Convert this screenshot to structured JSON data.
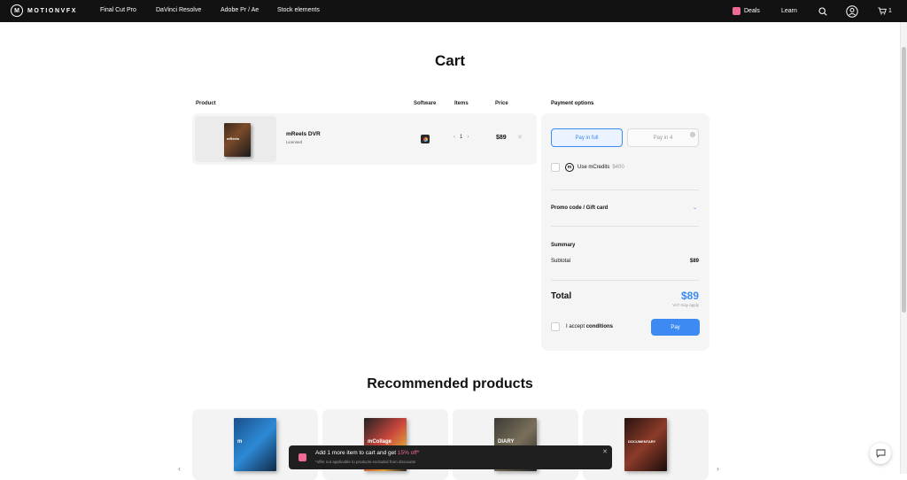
{
  "nav": {
    "brand": "MOTIONVFX",
    "links": [
      "Final Cut Pro",
      "DaVinci Resolve",
      "Adobe Pr / Ae",
      "Stock elements"
    ],
    "deals": "Deals",
    "learn": "Learn",
    "cart_count": "1"
  },
  "page": {
    "title": "Cart"
  },
  "cart": {
    "columns": {
      "product": "Product",
      "software": "Software",
      "items": "Items",
      "price": "Price"
    },
    "item": {
      "box_label": "mReels",
      "name": "mReels DVR",
      "license": "Licensed",
      "quantity": "1",
      "price": "$89",
      "software_icon": "davinci-resolve-icon"
    }
  },
  "payment": {
    "heading": "Payment options",
    "pay_in_full": "Pay in full",
    "pay_in_4": "Pay in 4",
    "mcredits_label": "Use mCredits",
    "mcredits_amount": "$400",
    "promo_label": "Promo code / Gift card",
    "summary_label": "Summary",
    "subtotal_label": "Subtotal",
    "subtotal_value": "$89",
    "total_label": "Total",
    "total_value": "$89",
    "vat_note": "VAT may apply",
    "accept_prefix": "I accept",
    "accept_link": "conditions",
    "pay_button": "Pay",
    "accent": "#3d8bf2"
  },
  "recommended": {
    "title": "Recommended products",
    "cards": [
      {
        "label": "m"
      },
      {
        "label": "mCollage"
      },
      {
        "label": "DIARY"
      },
      {
        "label": "DOCUMENTARY"
      }
    ]
  },
  "toast": {
    "message_prefix": "Add 1 more item to cart and get",
    "message_highlight": "15% off*",
    "note": "*offer not applicable to products excluded from discounts",
    "accent": "#f06b93"
  }
}
